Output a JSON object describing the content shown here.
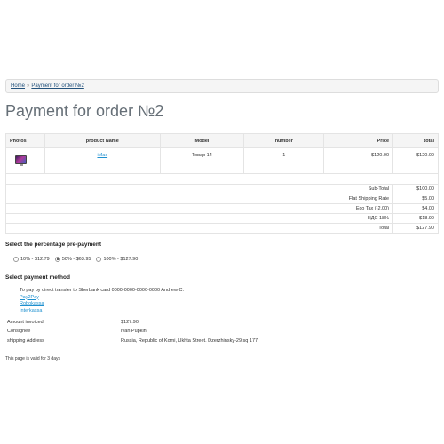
{
  "breadcrumb": {
    "home": "Home",
    "separator": "»",
    "current": "Payment for order №2"
  },
  "page_title": "Payment for order №2",
  "table": {
    "headers": {
      "photo": "Photos",
      "name": "product Name",
      "model": "Model",
      "number": "number",
      "price": "Price",
      "total": "total"
    },
    "product": {
      "image_icon": "imac-thumbnail-icon",
      "name": "iMac",
      "model": "Товар 14",
      "number": "1",
      "price": "$120.00",
      "total": "$120.00"
    },
    "totals": [
      {
        "label": "Sub-Total",
        "value": "$100.00"
      },
      {
        "label": "Flat Shipping Rate",
        "value": "$5.00"
      },
      {
        "label": "Eco Tax (-2.00)",
        "value": "$4.00"
      },
      {
        "label": "НДС 18%",
        "value": "$18.90"
      },
      {
        "label": "Total",
        "value": "$127.90"
      }
    ]
  },
  "prepayment": {
    "title": "Select the percentage pre-payment",
    "options": [
      {
        "label": "10% - $12.79",
        "checked": false
      },
      {
        "label": "50% - $63.95",
        "checked": true
      },
      {
        "label": "100% - $127.90",
        "checked": false
      }
    ]
  },
  "payment_method": {
    "title": "Select payment method",
    "items": [
      {
        "text": "To pay by direct transfer to Sberbank card 0000-0000-0000-0000 Andrew C.",
        "link": false
      },
      {
        "text": "Pay2Pay",
        "link": true
      },
      {
        "text": "Robokassa",
        "link": true
      },
      {
        "text": "Interkassa",
        "link": true
      }
    ]
  },
  "info": {
    "amount_label": "Amount invoiced",
    "amount_value": "$127.90",
    "consignee_label": "Consignee",
    "consignee_value": "Ivan Pupkin",
    "address_label": "shipping Address",
    "address_value": "Russia, Republic of Komi, Ukhta Street. Dzerzhinsky-29 sq 177"
  },
  "footnote": "This page is valid for 3 days"
}
